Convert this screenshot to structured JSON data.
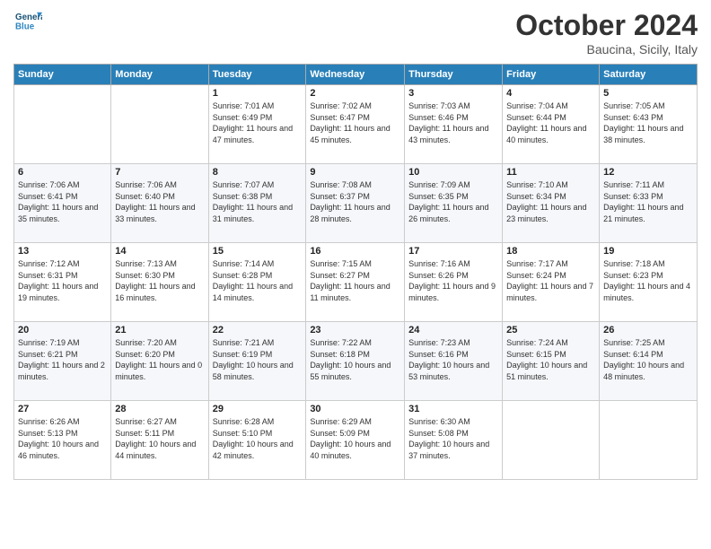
{
  "header": {
    "logo_line1": "General",
    "logo_line2": "Blue",
    "month_title": "October 2024",
    "location": "Baucina, Sicily, Italy"
  },
  "days_of_week": [
    "Sunday",
    "Monday",
    "Tuesday",
    "Wednesday",
    "Thursday",
    "Friday",
    "Saturday"
  ],
  "weeks": [
    [
      {
        "num": "",
        "info": ""
      },
      {
        "num": "",
        "info": ""
      },
      {
        "num": "1",
        "info": "Sunrise: 7:01 AM\nSunset: 6:49 PM\nDaylight: 11 hours and 47 minutes."
      },
      {
        "num": "2",
        "info": "Sunrise: 7:02 AM\nSunset: 6:47 PM\nDaylight: 11 hours and 45 minutes."
      },
      {
        "num": "3",
        "info": "Sunrise: 7:03 AM\nSunset: 6:46 PM\nDaylight: 11 hours and 43 minutes."
      },
      {
        "num": "4",
        "info": "Sunrise: 7:04 AM\nSunset: 6:44 PM\nDaylight: 11 hours and 40 minutes."
      },
      {
        "num": "5",
        "info": "Sunrise: 7:05 AM\nSunset: 6:43 PM\nDaylight: 11 hours and 38 minutes."
      }
    ],
    [
      {
        "num": "6",
        "info": "Sunrise: 7:06 AM\nSunset: 6:41 PM\nDaylight: 11 hours and 35 minutes."
      },
      {
        "num": "7",
        "info": "Sunrise: 7:06 AM\nSunset: 6:40 PM\nDaylight: 11 hours and 33 minutes."
      },
      {
        "num": "8",
        "info": "Sunrise: 7:07 AM\nSunset: 6:38 PM\nDaylight: 11 hours and 31 minutes."
      },
      {
        "num": "9",
        "info": "Sunrise: 7:08 AM\nSunset: 6:37 PM\nDaylight: 11 hours and 28 minutes."
      },
      {
        "num": "10",
        "info": "Sunrise: 7:09 AM\nSunset: 6:35 PM\nDaylight: 11 hours and 26 minutes."
      },
      {
        "num": "11",
        "info": "Sunrise: 7:10 AM\nSunset: 6:34 PM\nDaylight: 11 hours and 23 minutes."
      },
      {
        "num": "12",
        "info": "Sunrise: 7:11 AM\nSunset: 6:33 PM\nDaylight: 11 hours and 21 minutes."
      }
    ],
    [
      {
        "num": "13",
        "info": "Sunrise: 7:12 AM\nSunset: 6:31 PM\nDaylight: 11 hours and 19 minutes."
      },
      {
        "num": "14",
        "info": "Sunrise: 7:13 AM\nSunset: 6:30 PM\nDaylight: 11 hours and 16 minutes."
      },
      {
        "num": "15",
        "info": "Sunrise: 7:14 AM\nSunset: 6:28 PM\nDaylight: 11 hours and 14 minutes."
      },
      {
        "num": "16",
        "info": "Sunrise: 7:15 AM\nSunset: 6:27 PM\nDaylight: 11 hours and 11 minutes."
      },
      {
        "num": "17",
        "info": "Sunrise: 7:16 AM\nSunset: 6:26 PM\nDaylight: 11 hours and 9 minutes."
      },
      {
        "num": "18",
        "info": "Sunrise: 7:17 AM\nSunset: 6:24 PM\nDaylight: 11 hours and 7 minutes."
      },
      {
        "num": "19",
        "info": "Sunrise: 7:18 AM\nSunset: 6:23 PM\nDaylight: 11 hours and 4 minutes."
      }
    ],
    [
      {
        "num": "20",
        "info": "Sunrise: 7:19 AM\nSunset: 6:21 PM\nDaylight: 11 hours and 2 minutes."
      },
      {
        "num": "21",
        "info": "Sunrise: 7:20 AM\nSunset: 6:20 PM\nDaylight: 11 hours and 0 minutes."
      },
      {
        "num": "22",
        "info": "Sunrise: 7:21 AM\nSunset: 6:19 PM\nDaylight: 10 hours and 58 minutes."
      },
      {
        "num": "23",
        "info": "Sunrise: 7:22 AM\nSunset: 6:18 PM\nDaylight: 10 hours and 55 minutes."
      },
      {
        "num": "24",
        "info": "Sunrise: 7:23 AM\nSunset: 6:16 PM\nDaylight: 10 hours and 53 minutes."
      },
      {
        "num": "25",
        "info": "Sunrise: 7:24 AM\nSunset: 6:15 PM\nDaylight: 10 hours and 51 minutes."
      },
      {
        "num": "26",
        "info": "Sunrise: 7:25 AM\nSunset: 6:14 PM\nDaylight: 10 hours and 48 minutes."
      }
    ],
    [
      {
        "num": "27",
        "info": "Sunrise: 6:26 AM\nSunset: 5:13 PM\nDaylight: 10 hours and 46 minutes."
      },
      {
        "num": "28",
        "info": "Sunrise: 6:27 AM\nSunset: 5:11 PM\nDaylight: 10 hours and 44 minutes."
      },
      {
        "num": "29",
        "info": "Sunrise: 6:28 AM\nSunset: 5:10 PM\nDaylight: 10 hours and 42 minutes."
      },
      {
        "num": "30",
        "info": "Sunrise: 6:29 AM\nSunset: 5:09 PM\nDaylight: 10 hours and 40 minutes."
      },
      {
        "num": "31",
        "info": "Sunrise: 6:30 AM\nSunset: 5:08 PM\nDaylight: 10 hours and 37 minutes."
      },
      {
        "num": "",
        "info": ""
      },
      {
        "num": "",
        "info": ""
      }
    ]
  ]
}
